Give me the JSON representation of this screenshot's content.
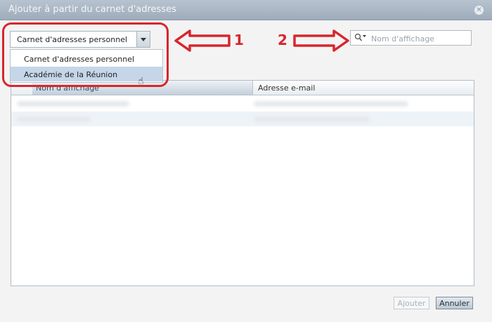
{
  "window": {
    "title": "Ajouter à partir du carnet d'adresses"
  },
  "addressbook": {
    "selected": "Carnet d'adresses personnel",
    "options": [
      "Carnet d'adresses personnel",
      "Académie de la Réunion"
    ]
  },
  "search": {
    "placeholder": "Nom d'affichage"
  },
  "grid": {
    "columns": [
      "Nom d'affichage",
      "Adresse e-mail"
    ],
    "rows": [
      [
        "",
        ""
      ],
      [
        "",
        ""
      ]
    ]
  },
  "buttons": {
    "add": "Ajouter",
    "cancel": "Annuler"
  },
  "annotations": {
    "label1": "1",
    "label2": "2",
    "color": "#d7262d"
  },
  "icons": {
    "close": "close-icon",
    "dropdown": "chevron-down-icon",
    "search": "search-icon",
    "cursor": "hand-pointer-icon"
  }
}
